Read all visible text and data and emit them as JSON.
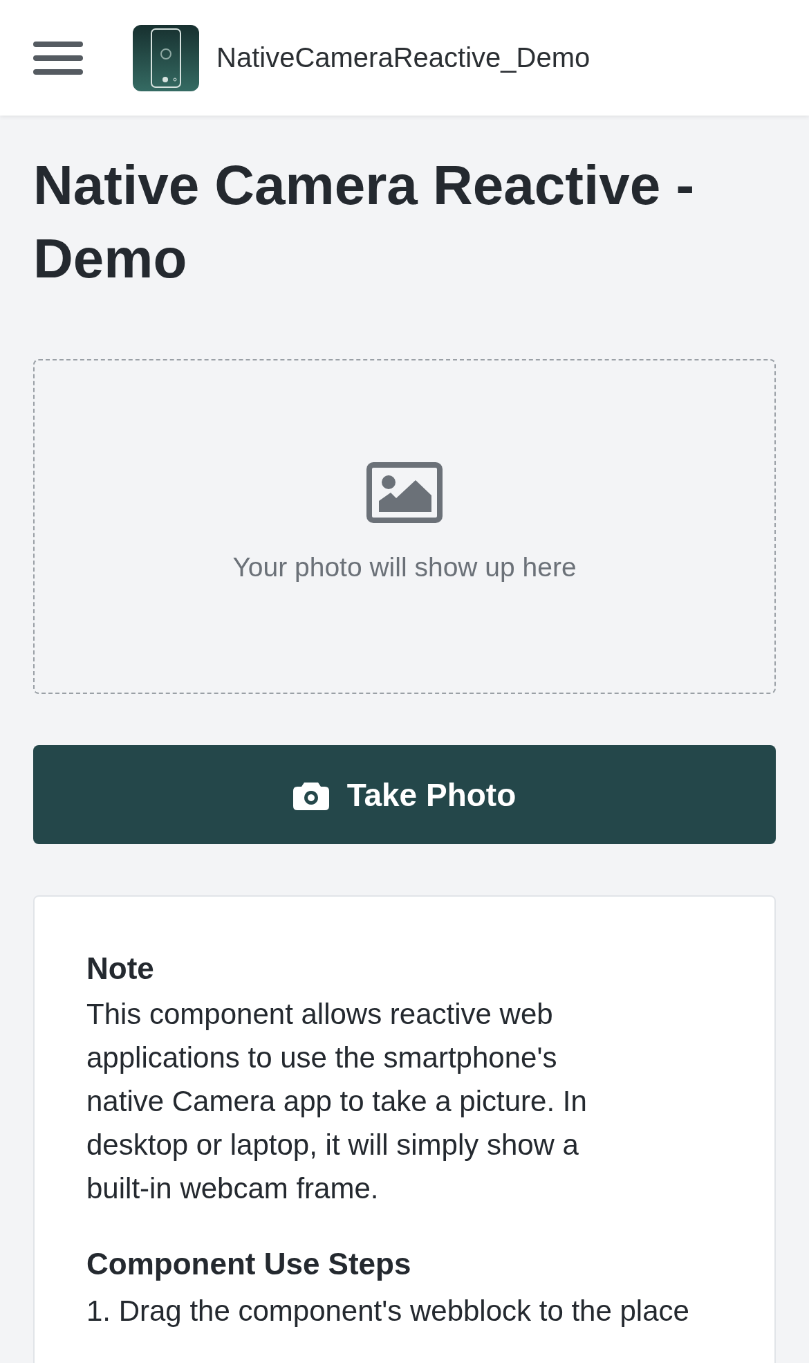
{
  "header": {
    "app_name": "NativeCameraReactive_Demo"
  },
  "title": "Native Camera Reactive - Demo",
  "photo_placeholder": {
    "text": "Your photo will show up here"
  },
  "take_photo_button": {
    "label": "Take Photo"
  },
  "note_card": {
    "heading": "Note",
    "body": "This component allows reactive web applications to use the smartphone's native Camera app to take a picture. In desktop or laptop, it will simply show a built-in webcam frame.",
    "steps_heading": "Component Use Steps",
    "steps": [
      "1. Drag the component's webblock to the place"
    ]
  }
}
